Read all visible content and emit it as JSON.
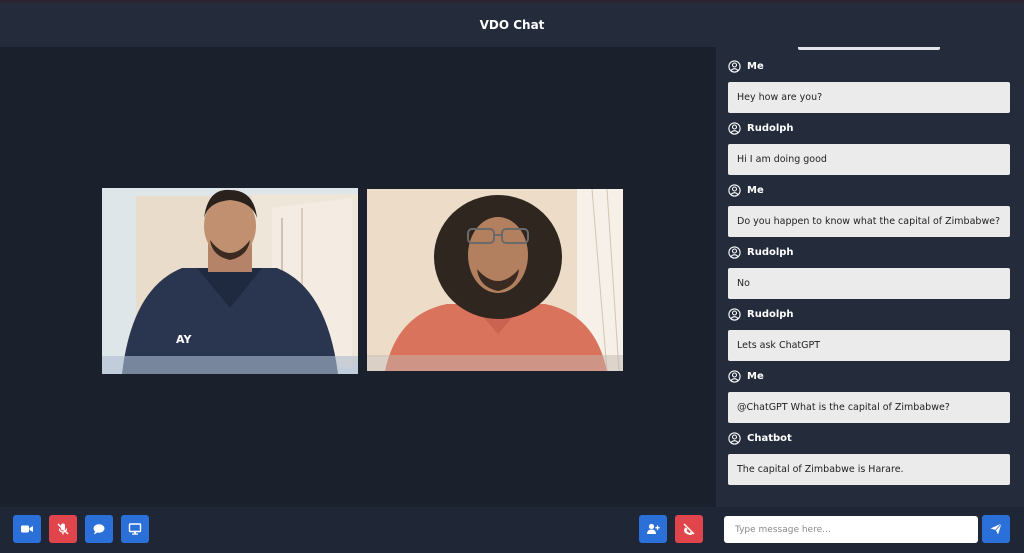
{
  "app": {
    "title": "VDO Chat"
  },
  "colors": {
    "primary": "#2b6fd8",
    "danger": "#e0454b",
    "background": "#1b202d",
    "panel": "#242c3c"
  },
  "videos": [
    {
      "icon": "participant-video-feed"
    },
    {
      "icon": "participant-video-feed"
    }
  ],
  "controls": {
    "left": [
      {
        "icon": "video-camera-icon",
        "color": "#2b6fd8"
      },
      {
        "icon": "microphone-off-icon",
        "color": "#e0454b"
      },
      {
        "icon": "chat-bubble-icon",
        "color": "#2b6fd8"
      },
      {
        "icon": "monitor-screen-share-icon",
        "color": "#2b6fd8"
      }
    ],
    "right": [
      {
        "icon": "add-user-icon",
        "color": "#2b6fd8"
      },
      {
        "icon": "end-call-icon",
        "color": "#e0454b"
      }
    ]
  },
  "chat": {
    "messages": [
      {
        "sender": "Me",
        "text": "Hey how are you?"
      },
      {
        "sender": "Rudolph",
        "text": "Hi I am doing good"
      },
      {
        "sender": "Me",
        "text": "Do you happen to know what the capital of Zimbabwe?"
      },
      {
        "sender": "Rudolph",
        "text": "No"
      },
      {
        "sender": "Rudolph",
        "text": "Lets ask ChatGPT"
      },
      {
        "sender": "Me",
        "text": "@ChatGPT What is the capital of Zimbabwe?"
      },
      {
        "sender": "Chatbot",
        "text": "The capital of Zimbabwe is Harare."
      }
    ],
    "input": {
      "placeholder": "Type message here...",
      "value": ""
    },
    "send_icon": "send-paper-plane-icon"
  }
}
